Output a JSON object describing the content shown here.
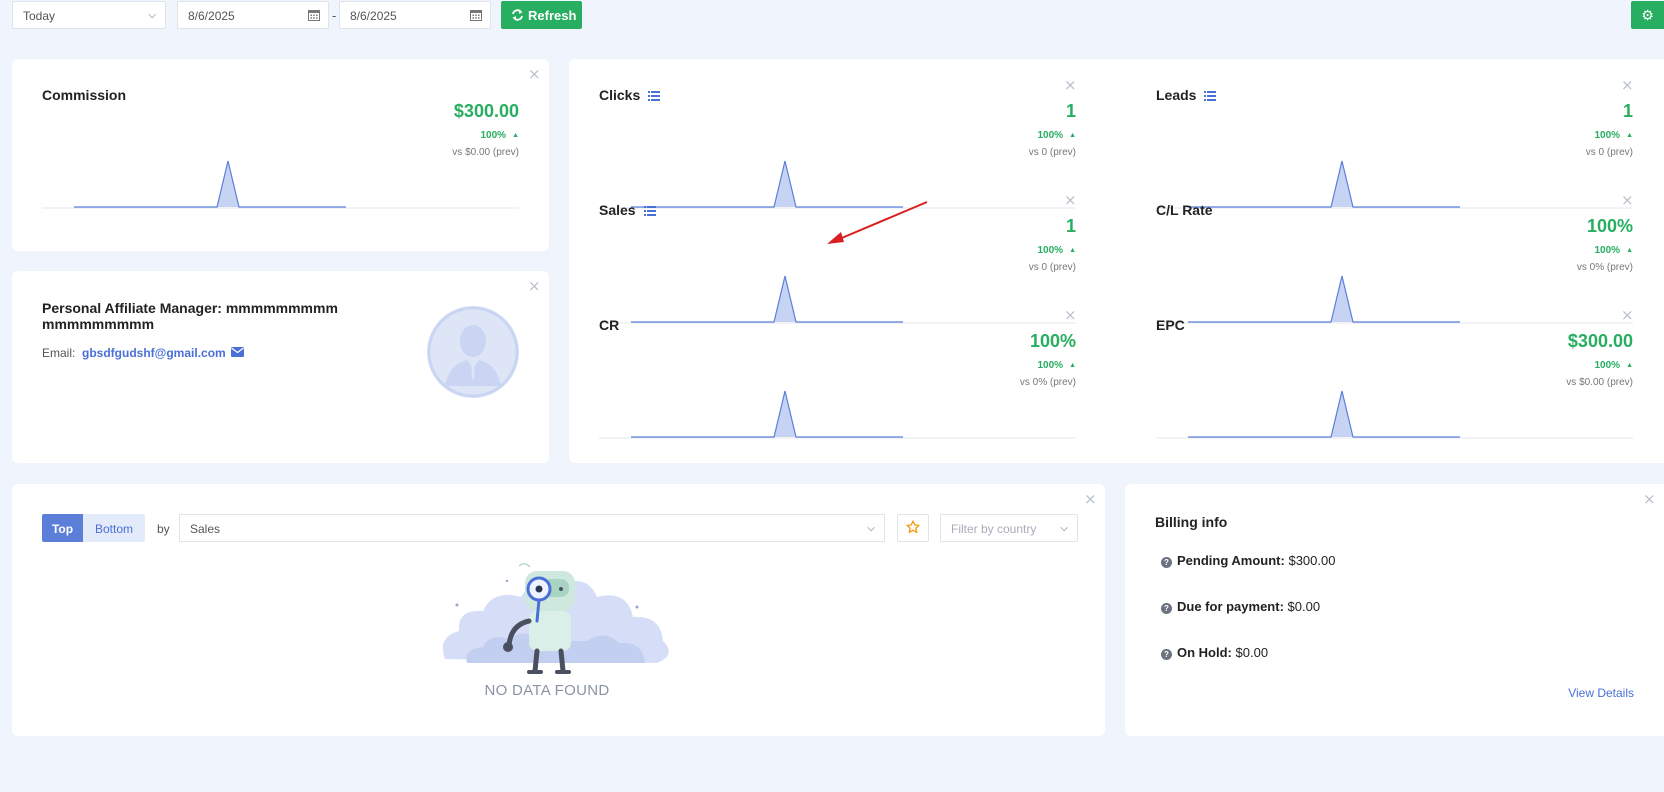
{
  "toolbar": {
    "period": "Today",
    "date_from": "8/6/2025",
    "date_to": "8/6/2025",
    "date_sep": "-",
    "refresh_label": "Refresh"
  },
  "commission": {
    "title": "Commission",
    "value": "$300.00",
    "pct": "100%",
    "prev": "vs $0.00 (prev)"
  },
  "metrics": {
    "clicks": {
      "title": "Clicks",
      "value": "1",
      "pct": "100%",
      "prev": "vs 0 (prev)"
    },
    "leads": {
      "title": "Leads",
      "value": "1",
      "pct": "100%",
      "prev": "vs 0 (prev)"
    },
    "sales": {
      "title": "Sales",
      "value": "1",
      "pct": "100%",
      "prev": "vs 0 (prev)"
    },
    "cl_rate": {
      "title": "C/L Rate",
      "value": "100%",
      "pct": "100%",
      "prev": "vs 0% (prev)"
    },
    "cr": {
      "title": "CR",
      "value": "100%",
      "pct": "100%",
      "prev": "vs 0% (prev)"
    },
    "epc": {
      "title": "EPC",
      "value": "$300.00",
      "pct": "100%",
      "prev": "vs $0.00 (prev)"
    }
  },
  "manager": {
    "title": "Personal Affiliate Manager: mmmmmmmmm mmmmmmmmm",
    "email_label": "Email:",
    "email": "gbsdfgudshf@gmail.com"
  },
  "ranking": {
    "top_label": "Top",
    "bottom_label": "Bottom",
    "by_label": "by",
    "sort_value": "Sales",
    "country_placeholder": "Filter by country",
    "no_data": "NO DATA FOUND"
  },
  "billing": {
    "title": "Billing info",
    "pending_label": "Pending Amount:",
    "pending_value": "$300.00",
    "due_label": "Due for payment:",
    "due_value": "$0.00",
    "hold_label": "On Hold:",
    "hold_value": "$0.00",
    "view_details": "View Details"
  },
  "colors": {
    "accent_green": "#27ae60",
    "accent_blue": "#5b7fd9",
    "chart_fill": "#c7d3f3",
    "chart_line": "#5b7fd9"
  },
  "icons": [
    "calendar-icon",
    "refresh-icon",
    "gear-icon",
    "close-icon",
    "list-icon",
    "mail-icon",
    "star-icon",
    "help-icon",
    "chevron-down-icon",
    "user-avatar-icon",
    "arrow-up-icon"
  ]
}
